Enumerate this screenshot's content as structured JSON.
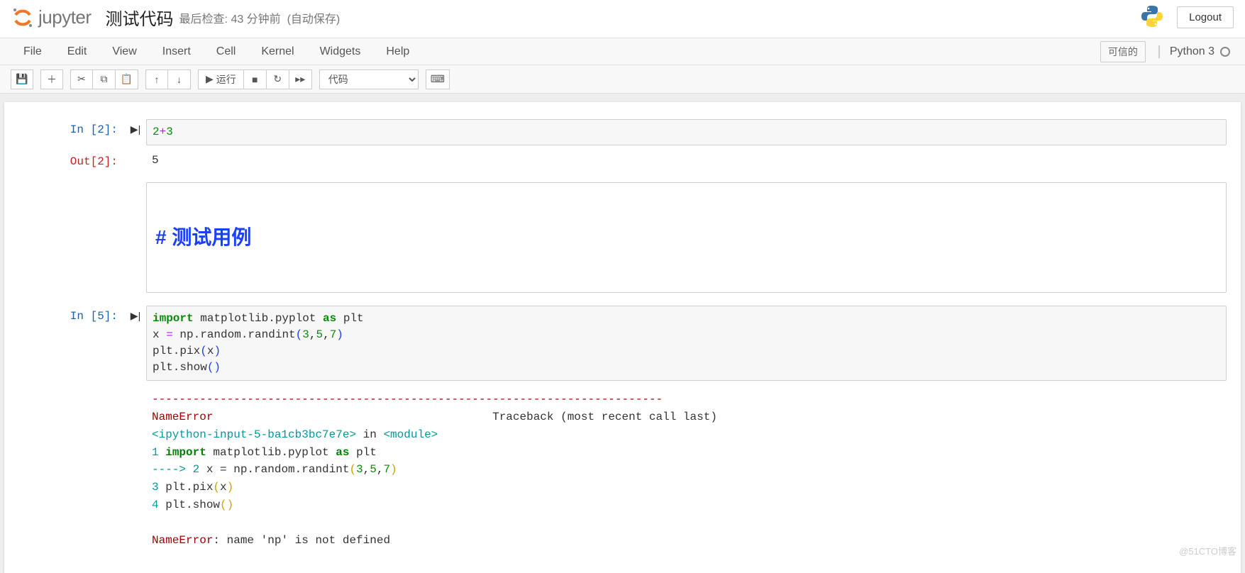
{
  "header": {
    "logo_text": "jupyter",
    "notebook_title": "测试代码",
    "last_checkpoint": "最后检查: 43 分钟前",
    "autosave": "(自动保存)",
    "logout": "Logout"
  },
  "menubar": {
    "items": [
      "File",
      "Edit",
      "View",
      "Insert",
      "Cell",
      "Kernel",
      "Widgets",
      "Help"
    ],
    "trusted": "可信的",
    "kernel": "Python 3"
  },
  "toolbar": {
    "run_label": "运行",
    "cell_type": "代码"
  },
  "cells": [
    {
      "in_label": "In  [2]:",
      "code_html": "<span class='k-num'>2</span><span class='k-op'>+</span><span class='k-num'>3</span>",
      "out_label": "Out[2]:",
      "out_text": "5"
    },
    {
      "markdown_heading": "# 测试用例"
    },
    {
      "in_label": "In  [5]:",
      "code_html": "<span class='k-green'>import</span> matplotlib.pyplot <span class='k-green'>as</span> plt\nx <span class='k-op'>=</span> np.random.randint<span class='k-par'>(</span><span class='k-num'>3</span>,<span class='k-num'>5</span>,<span class='k-num'>7</span><span class='k-par'>)</span>\nplt.pix<span class='k-par'>(</span>x<span class='k-par'>)</span>\nplt.show<span class='k-par'>(</span><span class='k-par'>)</span>",
      "error": {
        "dash_line": "---------------------------------------------------------------------------",
        "name": "NameError",
        "traceback_label": "Traceback (most recent call last)",
        "frame_source": "<ipython-input-5-ba1cb3bc7e7e>",
        "in_kw": " in ",
        "module": "<module>",
        "lines": [
          {
            "arrow": "      ",
            "num": "1",
            "code_html": " <span class='err-green'>import</span> matplotlib.pyplot <span class='err-green'>as</span> plt"
          },
          {
            "arrow": "----> ",
            "num": "2",
            "code_html": " x = np.random.randint<span class='k-par-y'>(</span><span class='k-num'>3</span>,<span class='k-num'>5</span>,<span class='k-num'>7</span><span class='k-par-y'>)</span>"
          },
          {
            "arrow": "      ",
            "num": "3",
            "code_html": " plt.pix<span class='k-par-y'>(</span>x<span class='k-par-y'>)</span>"
          },
          {
            "arrow": "      ",
            "num": "4",
            "code_html": " plt.show<span class='k-par-y'>(</span><span class='k-par-y'>)</span>"
          }
        ],
        "final": "NameError",
        "final_msg": ": name 'np' is not defined"
      }
    }
  ],
  "watermark": "@51CTO博客"
}
